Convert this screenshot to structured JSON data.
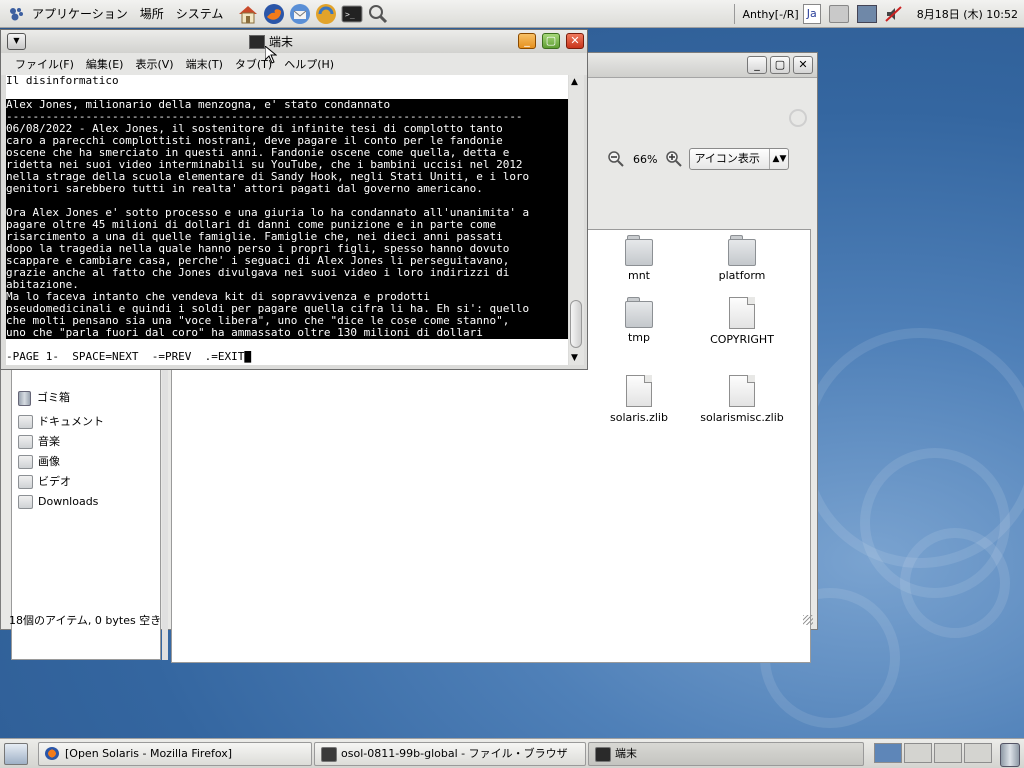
{
  "top_panel": {
    "menus": [
      "アプリケーション",
      "場所",
      "システム"
    ],
    "input_method": "Anthy[-/R]",
    "lang_chip": "Ja",
    "clock": "8月18日 (木) 10:52",
    "launcher_icons": [
      "home-icon",
      "firefox-icon",
      "thunderbird-icon",
      "update-icon",
      "terminal-icon",
      "search-icon"
    ]
  },
  "terminal": {
    "title": "端末",
    "menus": [
      "ファイル(F)",
      "編集(E)",
      "表示(V)",
      "端末(T)",
      "タブ(T)",
      "ヘルプ(H)"
    ],
    "lines": [
      {
        "text": "Il disinformatico",
        "hl": false
      },
      {
        "text": "",
        "hl": false
      },
      {
        "text": "Alex Jones, milionario della menzogna, e' stato condannato",
        "hl": true
      },
      {
        "text": "------------------------------------------------------------------------------",
        "hl": true
      },
      {
        "text": "06/08/2022 - Alex Jones, il sostenitore di infinite tesi di complotto tanto",
        "hl": true
      },
      {
        "text": "caro a parecchi complottisti nostrani, deve pagare il conto per le fandonie",
        "hl": true
      },
      {
        "text": "oscene che ha smerciato in questi anni. Fandonie oscene come quella, detta e",
        "hl": true
      },
      {
        "text": "ridetta nei suoi video interminabili su YouTube, che i bambini uccisi nel 2012",
        "hl": true
      },
      {
        "text": "nella strage della scuola elementare di Sandy Hook, negli Stati Uniti, e i loro",
        "hl": true
      },
      {
        "text": "genitori sarebbero tutti in realta' attori pagati dal governo americano.",
        "hl": true
      },
      {
        "text": "",
        "hl": true
      },
      {
        "text": "Ora Alex Jones e' sotto processo e una giuria lo ha condannato all'unanimita' a",
        "hl": true
      },
      {
        "text": "pagare oltre 45 milioni di dollari di danni come punizione e in parte come",
        "hl": true
      },
      {
        "text": "risarcimento a una di quelle famiglie. Famiglie che, nei dieci anni passati",
        "hl": true
      },
      {
        "text": "dopo la tragedia nella quale hanno perso i propri figli, spesso hanno dovuto",
        "hl": true
      },
      {
        "text": "scappare e cambiare casa, perche' i seguaci di Alex Jones li perseguitavano,",
        "hl": true
      },
      {
        "text": "grazie anche al fatto che Jones divulgava nei suoi video i loro indirizzi di",
        "hl": true
      },
      {
        "text": "abitazione.",
        "hl": true
      },
      {
        "text": "Ma lo faceva intanto che vendeva kit di sopravvivenza e prodotti",
        "hl": true
      },
      {
        "text": "pseudomedicinali e quindi i soldi per pagare quella cifra li ha. Eh si': quello",
        "hl": true
      },
      {
        "text": "che molti pensano sia una \"voce libera\", uno che \"dice le cose come stanno\",",
        "hl": true
      },
      {
        "text": "uno che \"parla fuori dal coro\" ha ammassato oltre 130 milioni di dollari",
        "hl": true
      },
      {
        "text": "",
        "hl": false
      },
      {
        "text": "-PAGE 1-  SPACE=NEXT  -=PREV  .=EXIT█",
        "hl": false
      }
    ]
  },
  "file_manager": {
    "zoom": "66%",
    "view_mode": "アイコン表示",
    "items": [
      {
        "name": "mnt",
        "kind": "folder"
      },
      {
        "name": "platform",
        "kind": "folder"
      },
      {
        "name": "tmp",
        "kind": "folder"
      },
      {
        "name": "COPYRIGHT",
        "kind": "file"
      },
      {
        "name": "solaris.zlib",
        "kind": "file"
      },
      {
        "name": "solarismisc.zlib",
        "kind": "file"
      }
    ],
    "sidebar": [
      {
        "label": "ゴミ箱",
        "icon": "trash-icon"
      },
      {
        "label": "ドキュメント",
        "icon": "folder-icon"
      },
      {
        "label": "音楽",
        "icon": "folder-icon"
      },
      {
        "label": "画像",
        "icon": "folder-icon"
      },
      {
        "label": "ビデオ",
        "icon": "folder-icon"
      },
      {
        "label": "Downloads",
        "icon": "folder-icon"
      }
    ],
    "status": "18個のアイテム, 0 bytes 空き"
  },
  "taskbar": {
    "tasks": [
      {
        "label": "[Open Solaris - Mozilla Firefox]",
        "active": false
      },
      {
        "label": "osol-0811-99b-global - ファイル・ブラウザ",
        "active": false
      },
      {
        "label": "端末",
        "active": true
      }
    ]
  },
  "colors": {
    "term_close": "#d6452a",
    "term_min": "#f0a030",
    "term_max": "#79b54a",
    "desktop": "#3f72ad"
  }
}
